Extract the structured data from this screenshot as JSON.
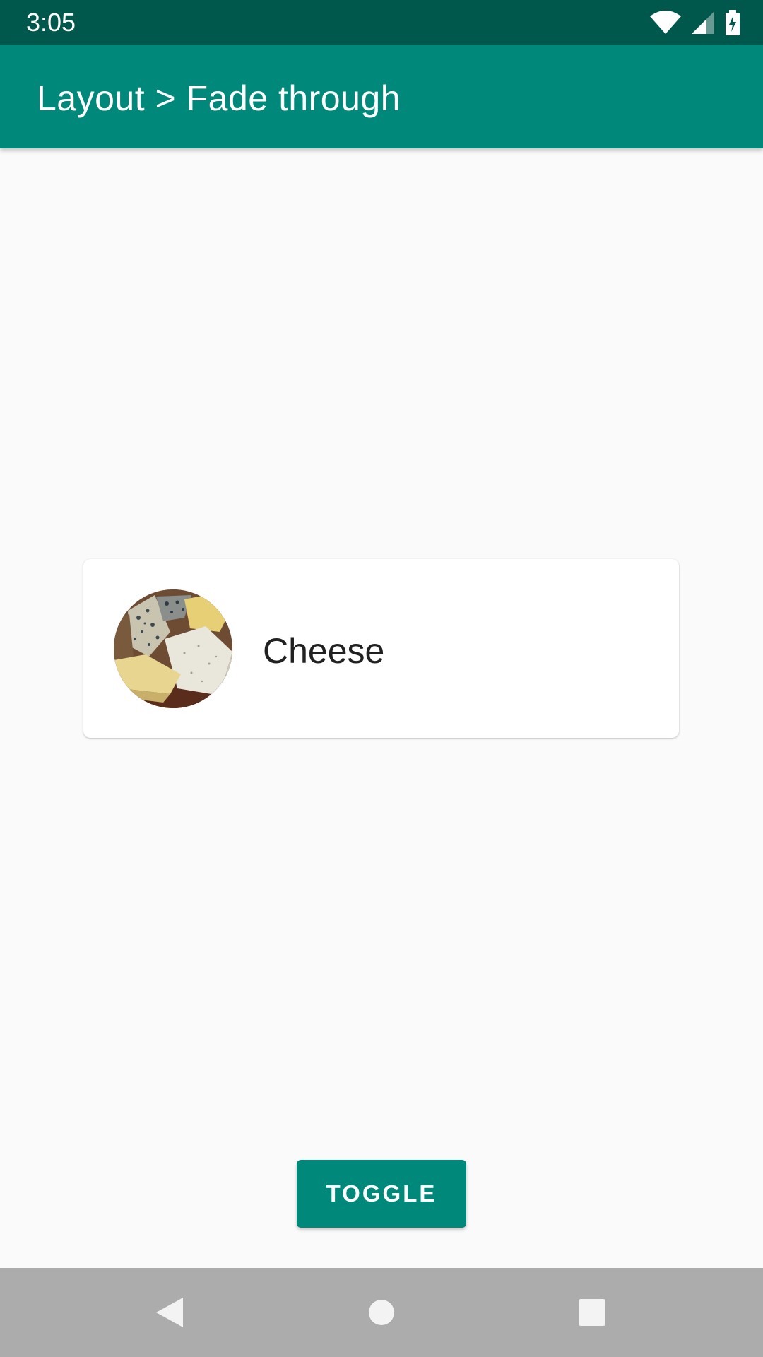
{
  "status_bar": {
    "time": "3:05",
    "icons": [
      "wifi-icon",
      "cellular-signal-icon",
      "battery-charging-icon"
    ]
  },
  "app_bar": {
    "title": "Layout > Fade through"
  },
  "card": {
    "image": "cheese-image",
    "label": "Cheese"
  },
  "toggle_button": {
    "label": "TOGGLE"
  },
  "nav_bar": {
    "buttons": [
      "back-icon",
      "home-icon",
      "recents-icon"
    ]
  },
  "colors": {
    "status_bar": "#00574b",
    "primary": "#00897b",
    "background": "#fafafa",
    "nav_bar": "#acacac"
  }
}
